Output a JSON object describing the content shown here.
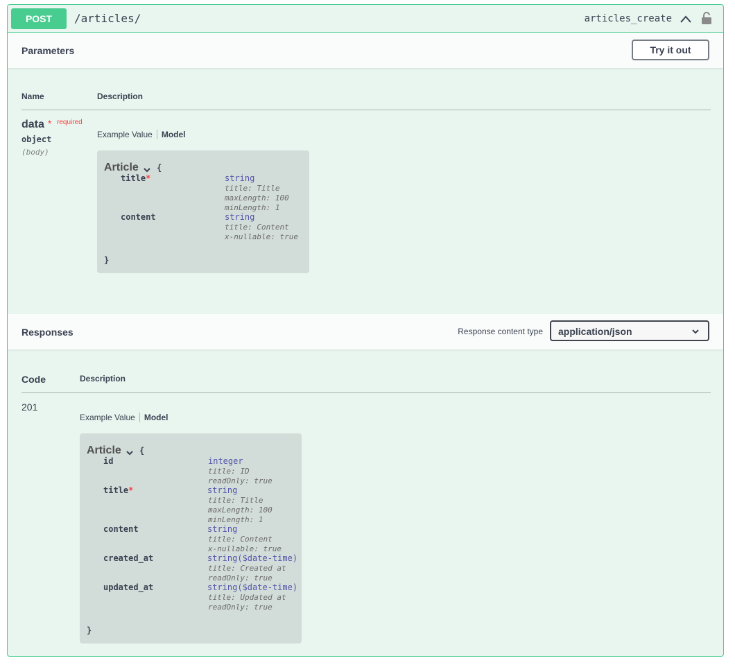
{
  "summary": {
    "method": "POST",
    "path": "/articles/",
    "operation_id": "articles_create",
    "collapse_icon": "chevron-up-icon",
    "auth_icon": "lock-icon"
  },
  "parameters": {
    "heading": "Parameters",
    "try_button": "Try it out",
    "col_name": "Name",
    "col_description": "Description",
    "param": {
      "name": "data",
      "required_star": "*",
      "required_label": "required",
      "type": "object",
      "in": "(body)"
    },
    "tab_example": "Example Value",
    "tab_model": "Model",
    "model": {
      "title": "Article",
      "open_brace": "{",
      "close_brace": "}",
      "props": [
        {
          "name": "title",
          "required": "*",
          "type": "string",
          "meta": [
            "title: Title",
            "maxLength: 100",
            "minLength: 1"
          ]
        },
        {
          "name": "content",
          "required": "",
          "type": "string",
          "meta": [
            "title: Content",
            "x-nullable: true"
          ]
        }
      ]
    }
  },
  "responses": {
    "heading": "Responses",
    "content_type_label": "Response content type",
    "content_type_value": "application/json",
    "col_code": "Code",
    "col_description": "Description",
    "code": "201",
    "tab_example": "Example Value",
    "tab_model": "Model",
    "model": {
      "title": "Article",
      "open_brace": "{",
      "close_brace": "}",
      "props": [
        {
          "name": "id",
          "required": "",
          "type": "integer",
          "meta": [
            "title: ID",
            "readOnly: true"
          ]
        },
        {
          "name": "title",
          "required": "*",
          "type": "string",
          "meta": [
            "title: Title",
            "maxLength: 100",
            "minLength: 1"
          ]
        },
        {
          "name": "content",
          "required": "",
          "type": "string",
          "meta": [
            "title: Content",
            "x-nullable: true"
          ]
        },
        {
          "name": "created_at",
          "required": "",
          "type": "string($date-time)",
          "meta": [
            "title: Created at",
            "readOnly: true"
          ]
        },
        {
          "name": "updated_at",
          "required": "",
          "type": "string($date-time)",
          "meta": [
            "title: Updated at",
            "readOnly: true"
          ]
        }
      ]
    }
  },
  "colors": {
    "accent": "#49cc90",
    "background": "#e8f6ef",
    "required": "#f93e3e",
    "type": "#5555aa"
  }
}
